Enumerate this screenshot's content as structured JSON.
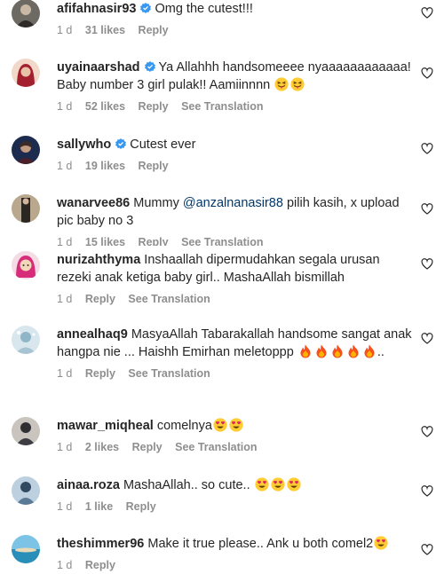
{
  "verified_color": "#3897f0",
  "comments": [
    {
      "username": "afifahnasir93",
      "text": "Omg the cutest!!!",
      "time": "1 d",
      "likes": "31 likes",
      "reply": "Reply"
    },
    {
      "username": "uyainaarshad",
      "text": "Ya Allahhh handsomeeee nyaaaaaaaaaaaa! Baby number 3 girl pulak!! Aamiinnnn",
      "time": "1 d",
      "likes": "52 likes",
      "reply": "Reply",
      "see_translation": "See Translation"
    },
    {
      "username": "sallywho",
      "text": "Cutest ever",
      "time": "1 d",
      "likes": "19 likes",
      "reply": "Reply"
    },
    {
      "username": "wanarvee86",
      "text_before": "Mummy ",
      "mention": "@anzalnanasir88",
      "text_after": " pilih kasih, x upload pic baby no 3",
      "time": "1 d",
      "likes": "15 likes",
      "reply": "Reply",
      "see_translation": "See Translation"
    },
    {
      "username": "nurizahthyma",
      "text": "Inshaallah dipermudahkan segala urusan rezeki anak ketiga baby girl.. MashaAllah bismillah",
      "time": "1 d",
      "reply": "Reply",
      "see_translation": "See Translation"
    },
    {
      "username": "annealhaq9",
      "text": "MasyaAllah Tabarakallah handsome sangat anak hangpa nie ... Haishh Emirhan meletoppp",
      "text_end": "..",
      "time": "1 d",
      "reply": "Reply",
      "see_translation": "See Translation"
    },
    {
      "username": "mawar_miqheal",
      "text": "comelnya",
      "time": "1 d",
      "likes": "2 likes",
      "reply": "Reply",
      "see_translation": "See Translation"
    },
    {
      "username": "ainaa.roza",
      "text": "MashaAllah.. so cute..",
      "time": "1 d",
      "likes": "1 like",
      "reply": "Reply"
    },
    {
      "username": "theshimmer96",
      "text": "Make it true please.. Ank u both comel2",
      "time": "1 d",
      "reply": "Reply"
    }
  ]
}
